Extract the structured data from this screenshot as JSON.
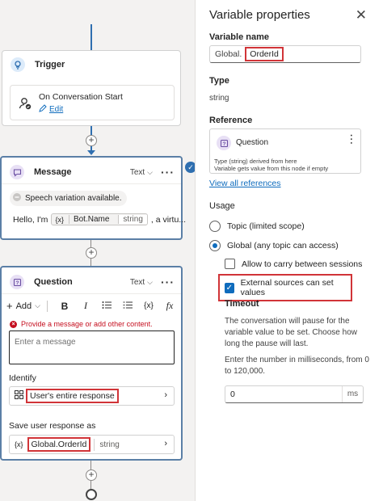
{
  "canvas": {
    "trigger": {
      "title": "Trigger",
      "event": "On Conversation Start",
      "edit_label": "Edit"
    },
    "message": {
      "title": "Message",
      "type_label": "Text",
      "speech_note": "Speech variation available.",
      "text_prefix": "Hello, I'm",
      "var_icon": "{x}",
      "var_name": "Bot.Name",
      "var_type": "string",
      "text_suffix": ", a virtu..."
    },
    "question": {
      "title": "Question",
      "type_label": "Text",
      "toolbar": {
        "add_label": "Add",
        "bold": "B",
        "italic": "I",
        "variable": "{x}",
        "formula": "fx"
      },
      "error": "Provide a message or add other content.",
      "message_placeholder": "Enter a message",
      "identify_label": "Identify",
      "identify_value": "User's entire response",
      "save_label": "Save user response as",
      "save_var_icon": "{x}",
      "save_var_name": "Global.OrderId",
      "save_var_type": "string"
    }
  },
  "panel": {
    "title": "Variable properties",
    "variable_name_label": "Variable name",
    "variable_prefix": "Global.",
    "variable_name": "OrderId",
    "type_label": "Type",
    "type_value": "string",
    "reference_label": "Reference",
    "reference_node": "Question",
    "reference_desc_1": "Type (string) derived from here",
    "reference_desc_2": "Variable gets value from this node if empty",
    "view_all_label": "View all references",
    "usage_label": "Usage",
    "usage_options": [
      "Topic (limited scope)",
      "Global (any topic can access)"
    ],
    "usage_selected": 1,
    "allow_carry_label": "Allow to carry between sessions",
    "allow_carry_checked": false,
    "external_sources_label": "External sources can set values",
    "external_sources_checked": true,
    "timeout_label": "Timeout",
    "timeout_desc": "The conversation will pause for the variable value to be set. Choose how long the pause will last.",
    "timeout_instruction": "Enter the number in milliseconds, from 0 to 120,000.",
    "timeout_value": "0",
    "timeout_unit": "ms"
  },
  "colors": {
    "accent": "#0f6cbd",
    "highlight": "#d13438",
    "connector": "#2f6fb0"
  },
  "icons": [
    "trigger-icon",
    "conversation-start-icon",
    "edit-icon",
    "message-icon",
    "speech-icon",
    "question-icon",
    "bold-icon",
    "italic-icon",
    "list-icon",
    "variable-icon",
    "formula-icon",
    "error-icon",
    "identify-icon",
    "chevron-right-icon",
    "close-icon",
    "more-icon",
    "check-icon"
  ]
}
